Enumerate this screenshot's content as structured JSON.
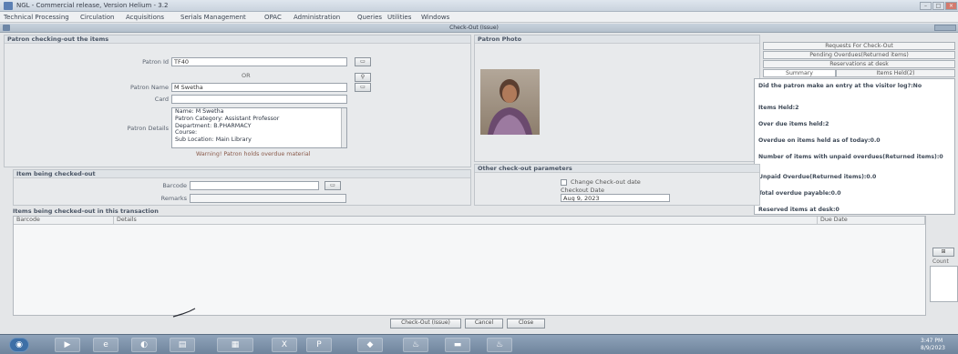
{
  "window": {
    "title": "NGL - Commercial release, Version Helium - 3.2"
  },
  "menu": [
    "Technical Processing",
    "Circulation",
    "Acquisitions",
    "Serials Management",
    "OPAC",
    "Administration",
    "Queries",
    "Utilities",
    "Windows"
  ],
  "inner_title": "Check-Out (Issue)",
  "patron_section": {
    "header": "Patron checking-out the items",
    "patron_id_label": "Patron Id",
    "patron_id_value": "TF40",
    "or_label": "OR",
    "patron_name_label": "Patron Name",
    "patron_name_value": "M Swetha",
    "card_label": "Card",
    "details_label": "Patron Details",
    "details_lines": [
      "Name: M Swetha",
      "Patron Category: Assistant Professor",
      "Department: B.PHARMACY",
      "Course:",
      "Sub Location: Main Library"
    ],
    "warning": "Warning! Patron holds overdue material"
  },
  "photo_section": {
    "header": "Patron Photo"
  },
  "right_panel": {
    "buttons": [
      "Requests For Check-Out",
      "Pending Overdues(Returned items)",
      "Reservations at desk"
    ],
    "tabs": [
      "Summary",
      "Items Held(2)"
    ],
    "info": [
      "Did the patron make an entry at the visitor log?:No",
      "Items Held:2",
      "Over due items held:2",
      "Overdue on items held as of today:0.0",
      "Number of items with unpaid overdues(Returned items):0",
      "Unpaid Overdue(Returned items):0.0",
      "Total overdue payable:0.0",
      "Reserved items at desk:0"
    ]
  },
  "item_section": {
    "header": "Item being checked-out",
    "barcode_label": "Barcode",
    "remarks_label": "Remarks"
  },
  "other_params": {
    "header": "Other check-out parameters",
    "change_date_label": "Change Check-out date",
    "checkout_date_label": "Checkout Date",
    "checkout_date_value": "Aug 9, 2023"
  },
  "transaction": {
    "header": "Items being checked-out in this transaction",
    "columns": [
      "Barcode",
      "Details",
      "Due Date"
    ],
    "side_label": "Count"
  },
  "actions": [
    "Check-Out (Issue)",
    "Cancel",
    "Close"
  ],
  "taskbar": {
    "time": "3:47 PM",
    "date": "8/9/2023"
  },
  "colors": {
    "accent": "#2a4d8f",
    "taskbar": "#7d91a8"
  }
}
